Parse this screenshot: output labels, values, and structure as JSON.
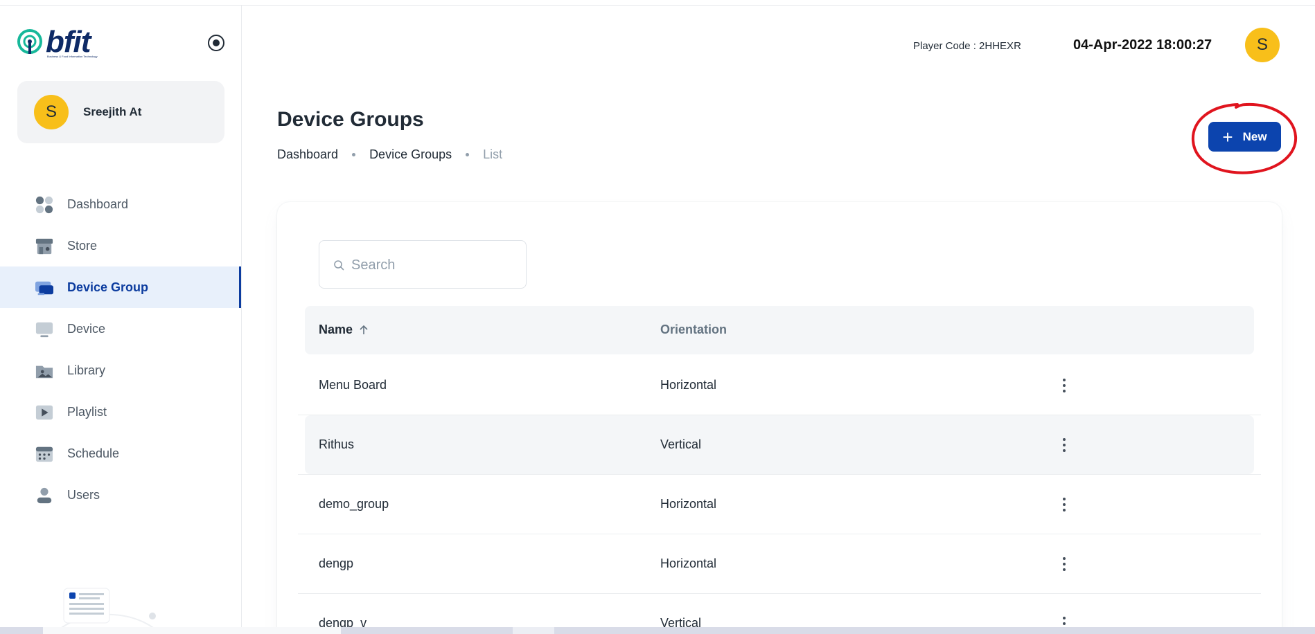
{
  "sidebar": {
    "logo_text": "bfit",
    "logo_subtext": "Business & Food Information Technology",
    "user": {
      "initial": "S",
      "name": "Sreejith At"
    },
    "items": [
      {
        "label": "Dashboard",
        "icon": "dashboard-icon",
        "active": false
      },
      {
        "label": "Store",
        "icon": "store-icon",
        "active": false
      },
      {
        "label": "Device Group",
        "icon": "device-group-icon",
        "active": true
      },
      {
        "label": "Device",
        "icon": "device-icon",
        "active": false
      },
      {
        "label": "Library",
        "icon": "library-icon",
        "active": false
      },
      {
        "label": "Playlist",
        "icon": "playlist-icon",
        "active": false
      },
      {
        "label": "Schedule",
        "icon": "schedule-icon",
        "active": false
      },
      {
        "label": "Users",
        "icon": "users-icon",
        "active": false
      }
    ]
  },
  "header": {
    "player_code": "Player Code : 2HHEXR",
    "datetime": "04-Apr-2022 18:00:27",
    "avatar_initial": "S"
  },
  "page": {
    "title": "Device Groups",
    "breadcrumb": [
      "Dashboard",
      "Device Groups",
      "List"
    ],
    "new_button_label": "New"
  },
  "search": {
    "placeholder": "Search",
    "value": ""
  },
  "table": {
    "columns": [
      "Name",
      "Orientation"
    ],
    "rows": [
      {
        "name": "Menu Board",
        "orientation": "Horizontal"
      },
      {
        "name": "Rithus",
        "orientation": "Vertical"
      },
      {
        "name": "demo_group",
        "orientation": "Horizontal"
      },
      {
        "name": "dengp",
        "orientation": "Horizontal"
      },
      {
        "name": "dengp_v",
        "orientation": "Vertical"
      }
    ]
  },
  "colors": {
    "brand_blue": "#0c44ae",
    "avatar_yellow": "#f8bf1a",
    "annotation_red": "#e0141e",
    "active_bg": "#e8f0fb"
  }
}
